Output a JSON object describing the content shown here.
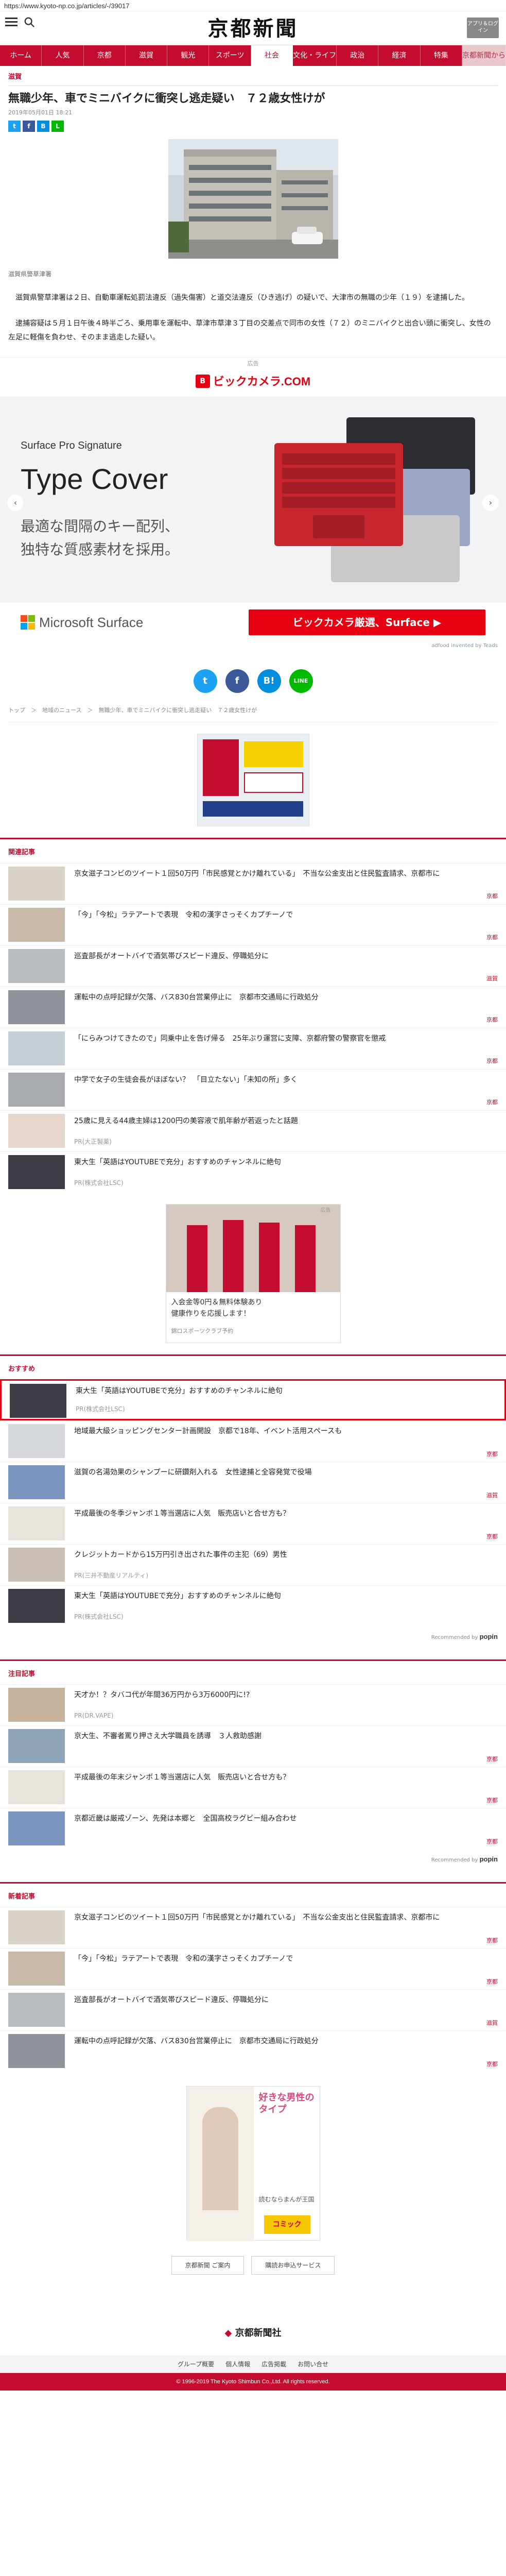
{
  "url": "https://www.kyoto-np.co.jp/articles/-/39017",
  "header": {
    "logo": "京都新聞",
    "login_label": "アプリ＆ログイン"
  },
  "nav": [
    "ホーム",
    "人気",
    "京都",
    "滋賀",
    "観光",
    "スポーツ",
    "社会",
    "文化・ライフ",
    "政治",
    "経済",
    "特集",
    "京都新聞から"
  ],
  "article": {
    "section": "滋賀",
    "headline": "無職少年、車でミニバイクに衝突し逃走疑い　７２歳女性けが",
    "datetime": "2019年05月01日 18:21",
    "photo_caption": "滋賀県警草津署",
    "paragraphs": [
      "滋賀県警草津署は２日、自動車運転処罰法違反（過失傷害）と道交法違反（ひき逃げ）の疑いで、大津市の無職の少年（１９）を逮捕した。",
      "逮捕容疑は５月１日午後４時半ごろ、乗用車を運転中、草津市草津３丁目の交差点で同市の女性（７２）のミニバイクと出合い頭に衝突し、女性の左足に軽傷を負わせ、そのまま逃走した疑い。"
    ],
    "share_small": [
      "t",
      "f",
      "B",
      "L"
    ],
    "share_big": [
      "t",
      "f",
      "B!",
      "LINE"
    ]
  },
  "ad": {
    "label": "広告",
    "brand": "ビックカメラ.COM",
    "subtitle": "Surface Pro Signature",
    "title": "Type Cover",
    "copy_1": "最適な間隔のキー配列、",
    "copy_2": "独特な質感素材を採用。",
    "ms_text": "Microsoft Surface",
    "cta": "ビックカメラ厳選、Surface ▶",
    "choice": "adfood invented by Teads"
  },
  "breadcrumb": "トップ　＞　地域のニュース　＞　無職少年、車でミニバイクに衝突し逃走疑い　７２歳女性けが",
  "related": {
    "heading": "関連記事",
    "items": [
      {
        "title": "京女滋子コンビのツイート１回50万円「市民感覚とかけ離れている」　不当な公金支出と住民監査請求、京都市に",
        "cat": "京都"
      },
      {
        "title": "「今」「今松」ラテアートで表現　令和の漢字さっそくカプチーノで",
        "cat": "京都"
      },
      {
        "title": "巡査部長がオートバイで酒気帯びスピード違反、停職処分に",
        "cat": "滋賀"
      },
      {
        "title": "運転中の点呼記録が欠落、バス830台営業停止に　京都市交通局に行政処分",
        "cat": "京都"
      },
      {
        "title": "「にらみつけてきたので」同乗中止を告げ帰る　25年ぶり運営に支障、京都府警の警察官を懲戒",
        "cat": "京都"
      },
      {
        "title": "中学で女子の生徒会長がほぼない？　「目立たない」「未知の所」多く",
        "cat": "京都"
      },
      {
        "title": "25歳に見える44歳主婦は1200円の美容液で肌年齢が若返ったと話題",
        "pr": "PR(大正製薬)"
      },
      {
        "title": "東大生「英語はYOUTUBEで充分」おすすめのチャンネルに絶句",
        "pr": "PR(株式会社LSC)"
      }
    ]
  },
  "mid_ad": {
    "line1": "入会金等0円＆無料体験あり",
    "line2": "健康作りを応援します！",
    "sub": "錦ロスポーツクラブ予約",
    "tag": "広告"
  },
  "recommend": {
    "heading": "おすすめ",
    "items": [
      {
        "title": "東大生「英語はYOUTUBEで充分」おすすめのチャンネルに絶句",
        "pr": "PR(株式会社LSC)"
      },
      {
        "title": "地域最大級ショッピングセンター計画開設　京都で18年、イベント活用スペースも",
        "cat": "京都"
      },
      {
        "title": "滋賀の名湯効果のシャンプーに研鑽剤入れる　女性逮捕と全容発覚で役場",
        "cat": "滋賀"
      },
      {
        "title": "平成最後の冬季ジャンボ１等当選店に人気　販売店いと合せ方も？",
        "cat": "京都"
      },
      {
        "title": "クレジットカードから15万円引き出された事件の主犯（69）男性",
        "pr": "PR(三井不動産リアルティ)"
      },
      {
        "title": "東大生「英語はYOUTUBEで充分」おすすめのチャンネルに絶句",
        "pr": "PR(株式会社LSC)"
      }
    ],
    "powered_text": "Recommended by",
    "powered_brand": "popin"
  },
  "attention": {
    "heading": "注目記事",
    "items": [
      {
        "title": "天才か！？タバコ代が年間36万円から3万6000円に!?",
        "pr": "PR(DR.VAPE)"
      },
      {
        "title": "京大生、不審者罵り押さえ大学職員を誘導　３人救助感謝",
        "cat": "京都"
      },
      {
        "title": "平成最後の年末ジャンボ１等当選店に人気　販売店いと合せ方も？",
        "cat": "京都"
      },
      {
        "title": "京都近畿は厳戒ゾーン、先発は本郷と　全国高校ラグビー組み合わせ",
        "cat": "京都"
      }
    ],
    "powered_text": "Recommended by",
    "powered_brand": "popin"
  },
  "latest": {
    "heading": "新着記事",
    "items": [
      {
        "title": "京女滋子コンビのツイート１回50万円「市民感覚とかけ離れている」　不当な公金支出と住民監査請求、京都市に",
        "cat": "京都"
      },
      {
        "title": "「今」「今松」ラテアートで表現　令和の漢字さっそくカプチーノで",
        "cat": "京都"
      },
      {
        "title": "巡査部長がオートバイで酒気帯びスピード違反、停職処分に",
        "cat": "滋賀"
      },
      {
        "title": "運転中の点呼記録が欠落、バス830台営業停止に　京都市交通局に行政処分",
        "cat": "京都"
      }
    ]
  },
  "bottom_ad": {
    "title": "好きな男性のタイプ",
    "sub": "読むならまんが王国",
    "brand": "コミック"
  },
  "foot_links": [
    "京都新聞 ご案内",
    "購読お申込サービス"
  ],
  "footer": {
    "logo": "京都新聞社",
    "nav": [
      "グループ概要",
      "個人情報",
      "広告掲載",
      "お問い合せ"
    ],
    "copyright": "© 1996-2019 The Kyoto Shimbun Co.,Ltd. All rights reserved."
  },
  "colors": {
    "brand_red": "#c40d2e",
    "twitter": "#1da1f2",
    "facebook": "#3b5998",
    "hatena": "#008fde",
    "line": "#00b900"
  }
}
